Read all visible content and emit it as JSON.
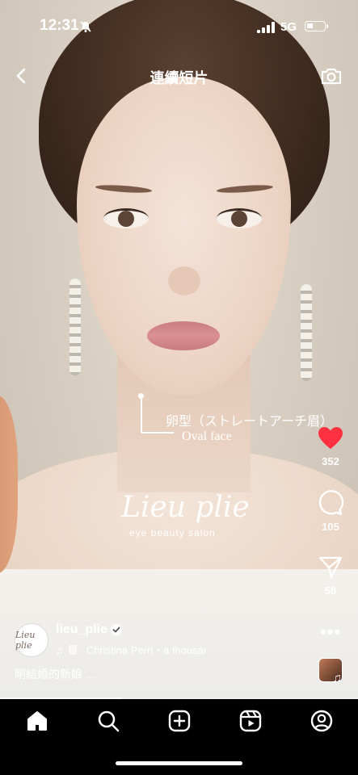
{
  "status_bar": {
    "time": "12:31",
    "network": "5G"
  },
  "header": {
    "title": "連續短片"
  },
  "overlay": {
    "annotation_jp": "卵型（ストレートアーチ眉）",
    "annotation_en": "Oval face",
    "watermark_script": "Lieu plie",
    "watermark_sub": "eye beauty salon"
  },
  "actions": {
    "likes": "352",
    "comments": "105",
    "shares": "58"
  },
  "post": {
    "avatar_text": "Lieu plie",
    "username": "lieu_plie",
    "audio": "Christina Perri・a thousand years",
    "caption": "剛結婚的新娘 ..."
  },
  "progress": 0.34,
  "colors": {
    "like": "#ff3040",
    "tabbar": "#000000"
  },
  "icons": [
    "back-icon",
    "camera-icon",
    "heart-icon",
    "comment-icon",
    "share-icon",
    "more-icon",
    "music-note-icon",
    "verified-icon",
    "home-icon",
    "search-icon",
    "create-icon",
    "reels-icon",
    "profile-icon"
  ]
}
